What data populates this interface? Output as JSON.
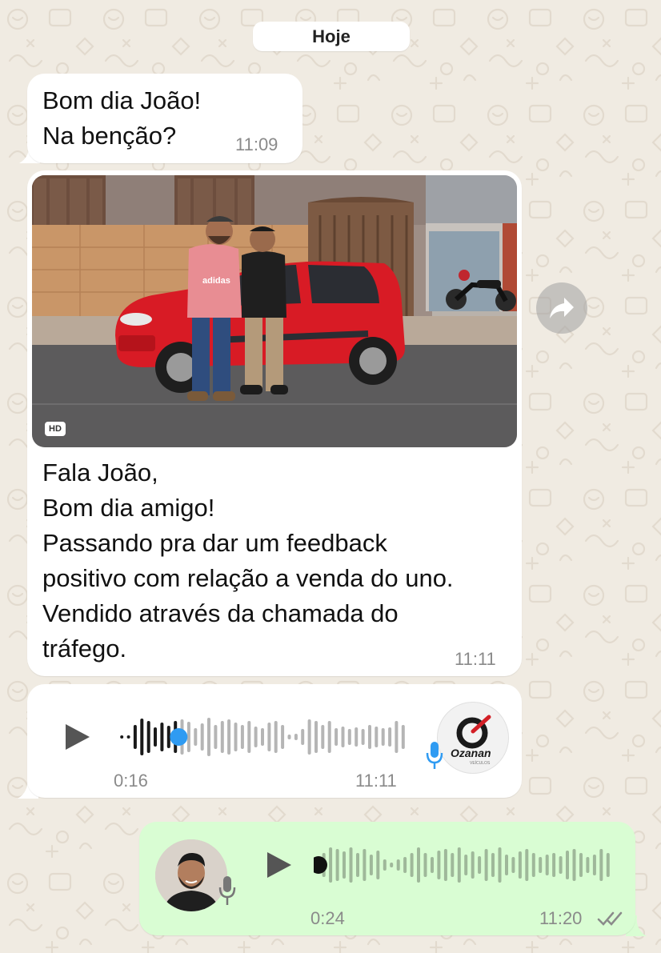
{
  "date_label": "Hoje",
  "messages": [
    {
      "type": "text",
      "direction": "in",
      "text": "Bom dia João!\nNa benção?",
      "time": "11:09"
    },
    {
      "type": "image",
      "direction": "in",
      "image_badge": "HD",
      "caption": "Fala João,\nBom dia amigo!\nPassando pra dar um feedback\npositivo com relação a venda do uno.\nVendido através da chamada do\ntráfego.",
      "time": "11:11",
      "shirt_text": "adidas"
    },
    {
      "type": "audio",
      "direction": "in",
      "duration": "0:16",
      "time": "11:11",
      "played_fraction": 0.2,
      "sender_logo_text": "Ozanan",
      "sender_logo_sub": "VEÍCULOS"
    },
    {
      "type": "audio",
      "direction": "out",
      "duration": "0:24",
      "time": "11:20",
      "played_fraction": 0.0,
      "status": "read"
    }
  ],
  "colors": {
    "background": "#f0ebe2",
    "incoming_bubble": "#ffffff",
    "outgoing_bubble": "#d9fdd3",
    "voice_blue": "#2f9bf2",
    "read_ticks": "#8a8a8a"
  },
  "icons": [
    "forward-icon",
    "play-icon",
    "microphone-icon",
    "double-check-icon",
    "hd-icon"
  ]
}
